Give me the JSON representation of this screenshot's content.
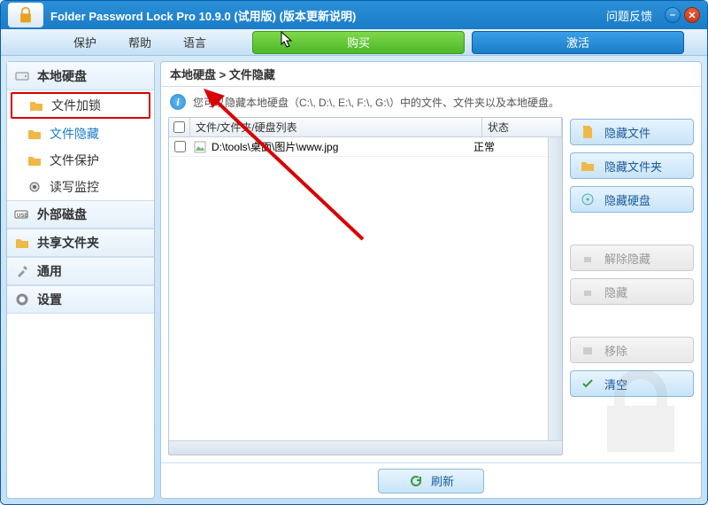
{
  "titlebar": {
    "title": "Folder Password Lock Pro 10.9.0 (试用版) (版本更新说明)",
    "feedback": "问题反馈"
  },
  "menubar": {
    "protect": "保护",
    "help": "帮助",
    "language": "语言",
    "buy": "购买",
    "activate": "激活"
  },
  "sidebar": {
    "local_disk": "本地硬盘",
    "items": [
      {
        "label": "文件加锁"
      },
      {
        "label": "文件隐藏"
      },
      {
        "label": "文件保护"
      },
      {
        "label": "读写监控"
      }
    ],
    "external": "外部磁盘",
    "shared": "共享文件夹",
    "general": "通用",
    "settings": "设置"
  },
  "content": {
    "breadcrumb": "本地硬盘 > 文件隐藏",
    "hint": "您可以隐藏本地硬盘（C:\\, D:\\, E:\\, F:\\, G:\\）中的文件、文件夹以及本地硬盘。",
    "columns": {
      "c1": "文件/文件夹/硬盘列表",
      "c2": "状态"
    },
    "rows": [
      {
        "path": "D:\\tools\\桌面\\图片\\www.jpg",
        "status": "正常"
      }
    ],
    "refresh": "刷新"
  },
  "actions": {
    "hide_file": "隐藏文件",
    "hide_folder": "隐藏文件夹",
    "hide_disk": "隐藏硬盘",
    "unhide": "解除隐藏",
    "hide": "隐藏",
    "remove": "移除",
    "clear": "清空"
  }
}
